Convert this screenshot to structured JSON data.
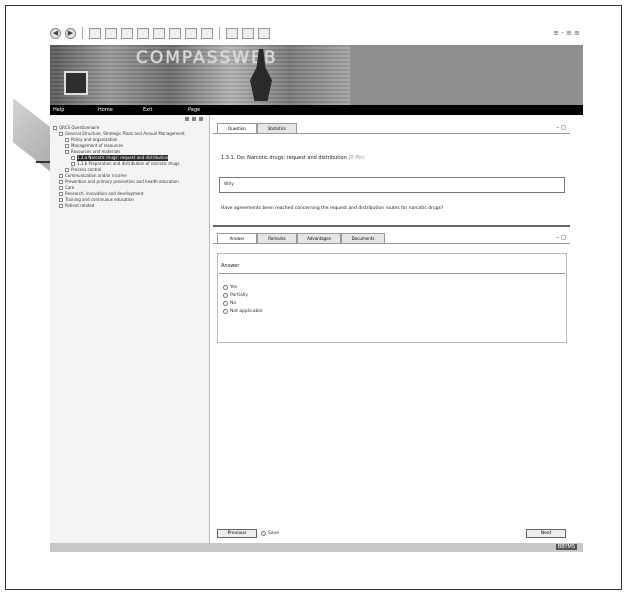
{
  "toolbar": {
    "right_text": "≡ - ≡ ≡"
  },
  "banner": {
    "logo": "COMPASSWEB"
  },
  "menubar": {
    "items": [
      "Help",
      "Home",
      "Exit",
      "Page"
    ]
  },
  "tree": {
    "items": [
      {
        "label": "QRCS Questionnaire",
        "indent": 0
      },
      {
        "label": "General Structure, Strategic Plans and Annual Management",
        "indent": 1
      },
      {
        "label": "Policy and organization",
        "indent": 2
      },
      {
        "label": "Management of resources",
        "indent": 2
      },
      {
        "label": "Resources and materials",
        "indent": 2
      },
      {
        "label": "1.3.a Narcotic drugs: request and distribution",
        "indent": 3,
        "selected": true
      },
      {
        "label": "1.3.b Preparation and distribution of narcotic drugs",
        "indent": 3
      },
      {
        "label": "Process control",
        "indent": 2
      },
      {
        "label": "Communication and/or income",
        "indent": 1
      },
      {
        "label": "Prevention and primary prevention and health education",
        "indent": 1
      },
      {
        "label": "Care",
        "indent": 1
      },
      {
        "label": "Research, innovation and development",
        "indent": 1
      },
      {
        "label": "Training and continuous education",
        "indent": 1
      },
      {
        "label": "Patient related",
        "indent": 1
      }
    ]
  },
  "content": {
    "tabs_top": [
      "Question",
      "Statistics"
    ],
    "question_title": "1.3.1. Do: Narcotic drugs: request and distribution",
    "question_sub": "(0 Pts)",
    "input_value": "Why",
    "question_text": "Have agreements been reached concerning the request and distribution routes for narcotic drugs?",
    "tabs_bottom": [
      "Answer",
      "Remarks",
      "Advantages",
      "Documents"
    ],
    "answer_header": "Answer",
    "options": [
      "Yes",
      "Partially",
      "No",
      "Not applicable"
    ],
    "previous_label": "Previous",
    "save_label": "Save",
    "next_label": "Next"
  },
  "status": {
    "text": "BBYM5"
  }
}
